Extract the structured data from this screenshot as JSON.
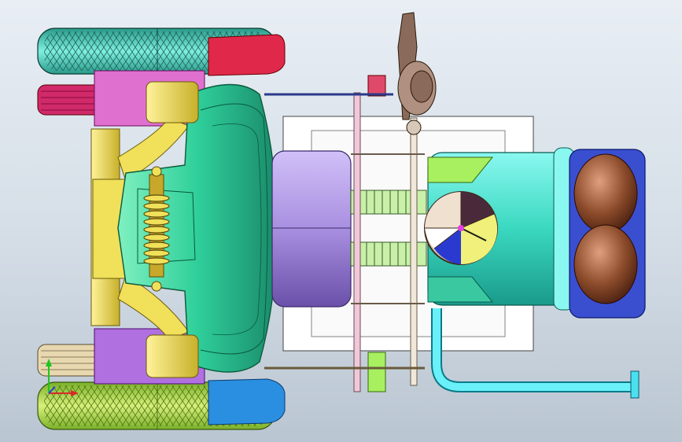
{
  "app": {
    "view": "cad-3d-viewport"
  },
  "colors": {
    "background_top": "#e8eef4",
    "background_bottom": "#b9c5d1",
    "tire_front": "#4fd1c5",
    "tire_rear": "#a8e04a",
    "fender_front": "#e0284a",
    "fender_rear": "#2a8fe0",
    "body": "#2fcf9a",
    "chassis_frame": "#f0e05a",
    "cylinder": "#a98fe0",
    "engine_block": "#ffffff",
    "intake_pipe": "#4ae0d0",
    "headlight_housing": "#3a4fd0",
    "headlight_lens": "#8a4a2a",
    "spring": "#f0e05a",
    "gauge_dial": "#f0f07a",
    "mast": "#8a6a5a",
    "exhaust_pipe": "#4ae0f0"
  },
  "icons": {
    "axis_triad": "xyz-axis-triad-icon"
  }
}
